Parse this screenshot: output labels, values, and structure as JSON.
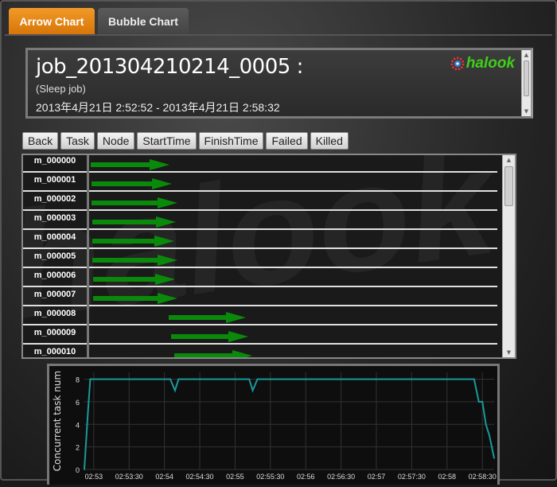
{
  "tabs": [
    {
      "label": "Arrow Chart",
      "active": true
    },
    {
      "label": "Bubble Chart",
      "active": false
    }
  ],
  "header": {
    "title": "job_201304210214_0005 :",
    "subtitle": "(Sleep job)",
    "time_range": "2013年4月21日 2:52:52 - 2013年4月21日 2:58:32",
    "logo": "halook"
  },
  "buttons": [
    "Back",
    "Task",
    "Node",
    "StartTime",
    "FinishTime",
    "Failed",
    "Killed"
  ],
  "colors": {
    "accent": "#e8840f",
    "arrow": "#0a8a0a",
    "line": "#1a9a9a",
    "logo": "#3fcf1a"
  },
  "tasks": [
    "m_000000",
    "m_000001",
    "m_000002",
    "m_000003",
    "m_000004",
    "m_000005",
    "m_000006",
    "m_000007",
    "m_000008",
    "m_000009",
    "m_000010"
  ],
  "watermark": "halook",
  "chart_data": {
    "type": "line",
    "ylabel": "Concurrent task num",
    "xlabel": "",
    "ylim": [
      0,
      8.6
    ],
    "yticks": [
      "0",
      "2",
      "4",
      "6",
      "8"
    ],
    "xlim": [
      "02:52:52",
      "02:58:40"
    ],
    "xticks": [
      "02:53",
      "02:53:30",
      "02:54",
      "02:54:30",
      "02:55",
      "02:55:30",
      "02:56",
      "02:56:30",
      "02:57",
      "02:57:30",
      "02:58",
      "02:58:30"
    ],
    "grid": true,
    "series": [
      {
        "points": [
          [
            "02:52:52",
            0
          ],
          [
            "02:52:55",
            5
          ],
          [
            "02:52:57",
            8
          ],
          [
            "02:54:05",
            8
          ],
          [
            "02:54:09",
            7
          ],
          [
            "02:54:12",
            8
          ],
          [
            "02:55:12",
            8
          ],
          [
            "02:55:15",
            7
          ],
          [
            "02:55:19",
            8
          ],
          [
            "02:58:23",
            8
          ],
          [
            "02:58:27",
            6
          ],
          [
            "02:58:30",
            6
          ],
          [
            "02:58:33",
            4
          ],
          [
            "02:58:36",
            3
          ],
          [
            "02:58:40",
            1
          ]
        ]
      }
    ]
  }
}
